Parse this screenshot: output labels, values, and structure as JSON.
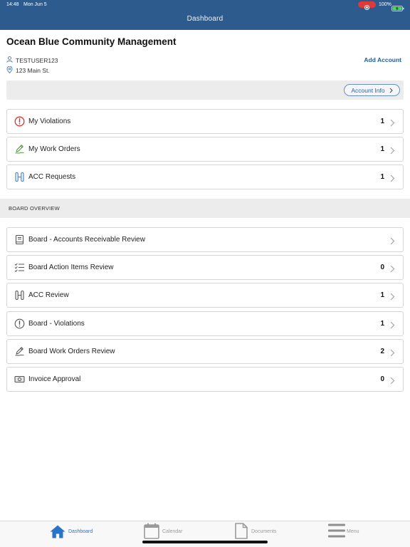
{
  "status_bar": {
    "time": "14:48",
    "date": "Mon Jun 5",
    "battery_level": "100%"
  },
  "header": {
    "title": "Dashboard"
  },
  "account": {
    "name": "Ocean Blue Community Management",
    "username": "TESTUSER123",
    "address": "123 Main St.",
    "add_account_label": "Add Account",
    "account_info_label": "Account Info"
  },
  "my_items": [
    {
      "label": "My Violations",
      "count": "1",
      "icon": "alert-circle-icon"
    },
    {
      "label": "My Work Orders",
      "count": "1",
      "icon": "pen-icon"
    },
    {
      "label": "ACC Requests",
      "count": "1",
      "icon": "acc-icon"
    }
  ],
  "board_overview": {
    "title": "BOARD OVERVIEW",
    "items": [
      {
        "label": "Board - Accounts Receivable Review",
        "icon": "book-icon"
      },
      {
        "label": "Board Action Items Review",
        "count": "0",
        "icon": "checklist-icon"
      },
      {
        "label": "ACC Review",
        "count": "1",
        "icon": "acc-icon"
      },
      {
        "label": "Board - Violations",
        "count": "1",
        "icon": "alert-circle-icon"
      },
      {
        "label": "Board Work Orders Review",
        "count": "2",
        "icon": "pen-icon"
      },
      {
        "label": "Invoice Approval",
        "count": "0",
        "icon": "money-bill-icon"
      }
    ]
  },
  "tab_bar": {
    "tabs": [
      {
        "label": "Dashboard",
        "icon": "home-icon",
        "active": true
      },
      {
        "label": "Calendar",
        "icon": "calendar-icon",
        "active": false
      },
      {
        "label": "Documents",
        "icon": "document-icon",
        "active": false
      },
      {
        "label": "Menu",
        "icon": "menu-icon",
        "active": false
      }
    ]
  },
  "colors": {
    "header_bg": "#2e5b8d",
    "accent_blue": "#1d5d9f",
    "violation_red": "#d6352d",
    "work_order_green": "#4f9a3d",
    "acc_blue": "#3f7fcc",
    "section_bg": "#ececec",
    "active_tab": "#2a74c8",
    "inactive_tab": "#9a9a9a"
  }
}
